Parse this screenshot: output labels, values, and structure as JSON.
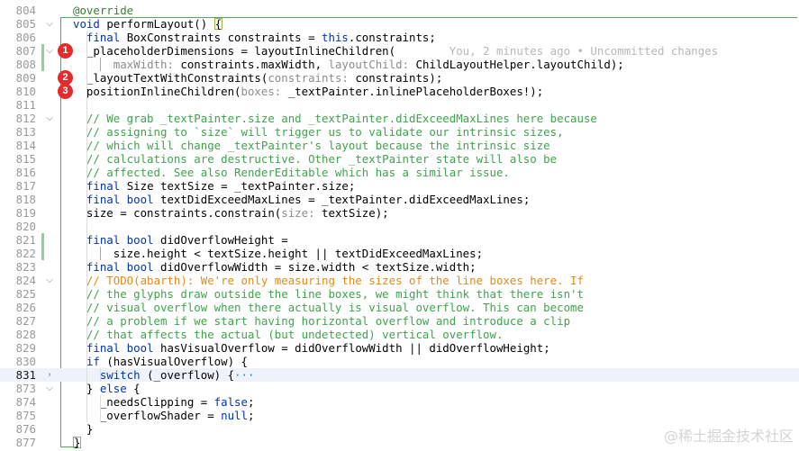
{
  "editor": {
    "lines": [
      {
        "n": "804",
        "segs": [
          {
            "t": "@override",
            "c": "ann"
          }
        ]
      },
      {
        "n": "805",
        "segs": [
          {
            "t": "void ",
            "c": "kw"
          },
          {
            "t": "performLayout() "
          },
          {
            "t": "{",
            "c": "box"
          }
        ]
      },
      {
        "n": "806",
        "segs": [
          {
            "t": "  "
          },
          {
            "t": "final ",
            "c": "kw"
          },
          {
            "t": "BoxConstraints constraints = "
          },
          {
            "t": "this",
            "c": "kw"
          },
          {
            "t": ".constraints;"
          }
        ]
      },
      {
        "n": "807",
        "segs": [
          {
            "t": "  _placeholderDimensions = layoutInlineChildren("
          },
          {
            "t": "        You, 2 minutes ago • Uncommitted changes",
            "c": "blame"
          }
        ]
      },
      {
        "n": "808",
        "segs": [
          {
            "t": "      "
          },
          {
            "t": "maxWidth: ",
            "c": "hint"
          },
          {
            "t": "constraints.maxWidth, "
          },
          {
            "t": "layoutChild: ",
            "c": "hint"
          },
          {
            "t": "ChildLayoutHelper.layoutChild);"
          }
        ]
      },
      {
        "n": "809",
        "segs": [
          {
            "t": "  _layoutTextWithConstraints("
          },
          {
            "t": "constraints: ",
            "c": "hint"
          },
          {
            "t": "constraints);"
          }
        ]
      },
      {
        "n": "810",
        "segs": [
          {
            "t": "  positionInlineChildren("
          },
          {
            "t": "boxes: ",
            "c": "hint"
          },
          {
            "t": "_textPainter.inlinePlaceholderBoxes!);"
          }
        ]
      },
      {
        "n": "811",
        "segs": []
      },
      {
        "n": "812",
        "segs": [
          {
            "t": "  // We grab _textPainter.size and _textPainter.didExceedMaxLines here because",
            "c": "cm"
          }
        ]
      },
      {
        "n": "813",
        "segs": [
          {
            "t": "  // assigning to `size` will trigger us to validate our intrinsic sizes,",
            "c": "cm"
          }
        ]
      },
      {
        "n": "814",
        "segs": [
          {
            "t": "  // which will change _textPainter's layout because the intrinsic size",
            "c": "cm"
          }
        ]
      },
      {
        "n": "815",
        "segs": [
          {
            "t": "  // calculations are destructive. Other _textPainter state will also be",
            "c": "cm"
          }
        ]
      },
      {
        "n": "816",
        "segs": [
          {
            "t": "  // affected. See also RenderEditable which has a similar issue.",
            "c": "cm"
          }
        ]
      },
      {
        "n": "817",
        "segs": [
          {
            "t": "  "
          },
          {
            "t": "final ",
            "c": "kw"
          },
          {
            "t": "Size textSize = _textPainter.size;"
          }
        ]
      },
      {
        "n": "818",
        "segs": [
          {
            "t": "  "
          },
          {
            "t": "final bool ",
            "c": "kw"
          },
          {
            "t": "textDidExceedMaxLines = _textPainter.didExceedMaxLines;"
          }
        ]
      },
      {
        "n": "819",
        "segs": [
          {
            "t": "  size = constraints.constrain("
          },
          {
            "t": "size: ",
            "c": "hint"
          },
          {
            "t": "textSize);"
          }
        ]
      },
      {
        "n": "820",
        "segs": []
      },
      {
        "n": "821",
        "segs": [
          {
            "t": "  "
          },
          {
            "t": "final bool ",
            "c": "kw"
          },
          {
            "t": "didOverflowHeight ="
          }
        ]
      },
      {
        "n": "822",
        "segs": [
          {
            "t": "      size.height < textSize.height || textDidExceedMaxLines;"
          }
        ]
      },
      {
        "n": "823",
        "segs": [
          {
            "t": "  "
          },
          {
            "t": "final bool ",
            "c": "kw"
          },
          {
            "t": "didOverflowWidth = size.width < textSize.width;"
          }
        ]
      },
      {
        "n": "824",
        "segs": [
          {
            "t": "  // TODO(abarth): We're only measuring the sizes of the line boxes here. If",
            "c": "todo"
          }
        ]
      },
      {
        "n": "825",
        "segs": [
          {
            "t": "  // the glyphs draw outside the line boxes, we might think that there isn't",
            "c": "cm"
          }
        ]
      },
      {
        "n": "826",
        "segs": [
          {
            "t": "  // visual overflow when there actually is visual overflow. This can become",
            "c": "cm"
          }
        ]
      },
      {
        "n": "827",
        "segs": [
          {
            "t": "  // a problem if we start having horizontal overflow and introduce a clip",
            "c": "cm"
          }
        ]
      },
      {
        "n": "828",
        "segs": [
          {
            "t": "  // that affects the actual (but undetected) vertical overflow.",
            "c": "cm"
          }
        ]
      },
      {
        "n": "829",
        "segs": [
          {
            "t": "  "
          },
          {
            "t": "final bool ",
            "c": "kw"
          },
          {
            "t": "hasVisualOverflow = didOverflowWidth || didOverflowHeight;"
          }
        ]
      },
      {
        "n": "830",
        "segs": [
          {
            "t": "  "
          },
          {
            "t": "if ",
            "c": "kw"
          },
          {
            "t": "(hasVisualOverflow) {"
          }
        ]
      },
      {
        "n": "831",
        "segs": [
          {
            "t": "    "
          },
          {
            "t": "switch ",
            "c": "kw"
          },
          {
            "t": "(_overflow) {"
          },
          {
            "t": "···",
            "c": "fold"
          }
        ]
      },
      {
        "n": "873",
        "segs": [
          {
            "t": "  } "
          },
          {
            "t": "else ",
            "c": "kw"
          },
          {
            "t": "{"
          }
        ]
      },
      {
        "n": "874",
        "segs": [
          {
            "t": "    _needsClipping = "
          },
          {
            "t": "false",
            "c": "kw"
          },
          {
            "t": ";"
          }
        ]
      },
      {
        "n": "875",
        "segs": [
          {
            "t": "    _overflowShader = "
          },
          {
            "t": "null",
            "c": "kw"
          },
          {
            "t": ";"
          }
        ]
      },
      {
        "n": "876",
        "segs": [
          {
            "t": "  }"
          }
        ]
      },
      {
        "n": "877",
        "segs": [
          {
            "t": "}",
            "c": "box"
          }
        ]
      }
    ]
  },
  "badges": [
    "1",
    "2",
    "3"
  ],
  "watermark": "@稀土掘金技术社区"
}
